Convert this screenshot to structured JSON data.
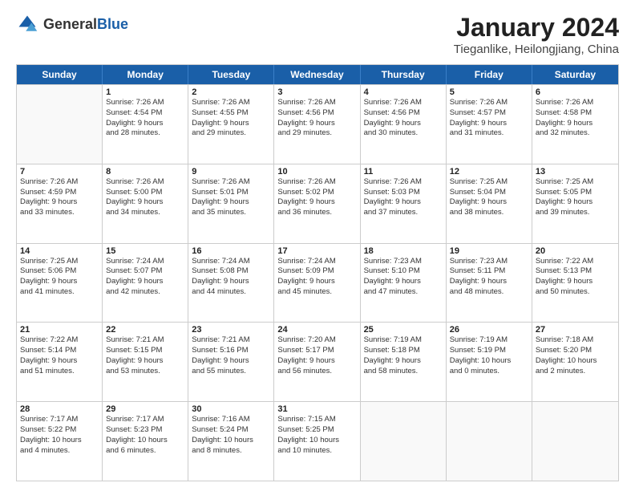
{
  "header": {
    "logo_general": "General",
    "logo_blue": "Blue",
    "title": "January 2024",
    "subtitle": "Tieganlike, Heilongjiang, China"
  },
  "days_of_week": [
    "Sunday",
    "Monday",
    "Tuesday",
    "Wednesday",
    "Thursday",
    "Friday",
    "Saturday"
  ],
  "rows": [
    [
      {
        "day": "",
        "lines": []
      },
      {
        "day": "1",
        "lines": [
          "Sunrise: 7:26 AM",
          "Sunset: 4:54 PM",
          "Daylight: 9 hours",
          "and 28 minutes."
        ]
      },
      {
        "day": "2",
        "lines": [
          "Sunrise: 7:26 AM",
          "Sunset: 4:55 PM",
          "Daylight: 9 hours",
          "and 29 minutes."
        ]
      },
      {
        "day": "3",
        "lines": [
          "Sunrise: 7:26 AM",
          "Sunset: 4:56 PM",
          "Daylight: 9 hours",
          "and 29 minutes."
        ]
      },
      {
        "day": "4",
        "lines": [
          "Sunrise: 7:26 AM",
          "Sunset: 4:56 PM",
          "Daylight: 9 hours",
          "and 30 minutes."
        ]
      },
      {
        "day": "5",
        "lines": [
          "Sunrise: 7:26 AM",
          "Sunset: 4:57 PM",
          "Daylight: 9 hours",
          "and 31 minutes."
        ]
      },
      {
        "day": "6",
        "lines": [
          "Sunrise: 7:26 AM",
          "Sunset: 4:58 PM",
          "Daylight: 9 hours",
          "and 32 minutes."
        ]
      }
    ],
    [
      {
        "day": "7",
        "lines": [
          "Sunrise: 7:26 AM",
          "Sunset: 4:59 PM",
          "Daylight: 9 hours",
          "and 33 minutes."
        ]
      },
      {
        "day": "8",
        "lines": [
          "Sunrise: 7:26 AM",
          "Sunset: 5:00 PM",
          "Daylight: 9 hours",
          "and 34 minutes."
        ]
      },
      {
        "day": "9",
        "lines": [
          "Sunrise: 7:26 AM",
          "Sunset: 5:01 PM",
          "Daylight: 9 hours",
          "and 35 minutes."
        ]
      },
      {
        "day": "10",
        "lines": [
          "Sunrise: 7:26 AM",
          "Sunset: 5:02 PM",
          "Daylight: 9 hours",
          "and 36 minutes."
        ]
      },
      {
        "day": "11",
        "lines": [
          "Sunrise: 7:26 AM",
          "Sunset: 5:03 PM",
          "Daylight: 9 hours",
          "and 37 minutes."
        ]
      },
      {
        "day": "12",
        "lines": [
          "Sunrise: 7:25 AM",
          "Sunset: 5:04 PM",
          "Daylight: 9 hours",
          "and 38 minutes."
        ]
      },
      {
        "day": "13",
        "lines": [
          "Sunrise: 7:25 AM",
          "Sunset: 5:05 PM",
          "Daylight: 9 hours",
          "and 39 minutes."
        ]
      }
    ],
    [
      {
        "day": "14",
        "lines": [
          "Sunrise: 7:25 AM",
          "Sunset: 5:06 PM",
          "Daylight: 9 hours",
          "and 41 minutes."
        ]
      },
      {
        "day": "15",
        "lines": [
          "Sunrise: 7:24 AM",
          "Sunset: 5:07 PM",
          "Daylight: 9 hours",
          "and 42 minutes."
        ]
      },
      {
        "day": "16",
        "lines": [
          "Sunrise: 7:24 AM",
          "Sunset: 5:08 PM",
          "Daylight: 9 hours",
          "and 44 minutes."
        ]
      },
      {
        "day": "17",
        "lines": [
          "Sunrise: 7:24 AM",
          "Sunset: 5:09 PM",
          "Daylight: 9 hours",
          "and 45 minutes."
        ]
      },
      {
        "day": "18",
        "lines": [
          "Sunrise: 7:23 AM",
          "Sunset: 5:10 PM",
          "Daylight: 9 hours",
          "and 47 minutes."
        ]
      },
      {
        "day": "19",
        "lines": [
          "Sunrise: 7:23 AM",
          "Sunset: 5:11 PM",
          "Daylight: 9 hours",
          "and 48 minutes."
        ]
      },
      {
        "day": "20",
        "lines": [
          "Sunrise: 7:22 AM",
          "Sunset: 5:13 PM",
          "Daylight: 9 hours",
          "and 50 minutes."
        ]
      }
    ],
    [
      {
        "day": "21",
        "lines": [
          "Sunrise: 7:22 AM",
          "Sunset: 5:14 PM",
          "Daylight: 9 hours",
          "and 51 minutes."
        ]
      },
      {
        "day": "22",
        "lines": [
          "Sunrise: 7:21 AM",
          "Sunset: 5:15 PM",
          "Daylight: 9 hours",
          "and 53 minutes."
        ]
      },
      {
        "day": "23",
        "lines": [
          "Sunrise: 7:21 AM",
          "Sunset: 5:16 PM",
          "Daylight: 9 hours",
          "and 55 minutes."
        ]
      },
      {
        "day": "24",
        "lines": [
          "Sunrise: 7:20 AM",
          "Sunset: 5:17 PM",
          "Daylight: 9 hours",
          "and 56 minutes."
        ]
      },
      {
        "day": "25",
        "lines": [
          "Sunrise: 7:19 AM",
          "Sunset: 5:18 PM",
          "Daylight: 9 hours",
          "and 58 minutes."
        ]
      },
      {
        "day": "26",
        "lines": [
          "Sunrise: 7:19 AM",
          "Sunset: 5:19 PM",
          "Daylight: 10 hours",
          "and 0 minutes."
        ]
      },
      {
        "day": "27",
        "lines": [
          "Sunrise: 7:18 AM",
          "Sunset: 5:20 PM",
          "Daylight: 10 hours",
          "and 2 minutes."
        ]
      }
    ],
    [
      {
        "day": "28",
        "lines": [
          "Sunrise: 7:17 AM",
          "Sunset: 5:22 PM",
          "Daylight: 10 hours",
          "and 4 minutes."
        ]
      },
      {
        "day": "29",
        "lines": [
          "Sunrise: 7:17 AM",
          "Sunset: 5:23 PM",
          "Daylight: 10 hours",
          "and 6 minutes."
        ]
      },
      {
        "day": "30",
        "lines": [
          "Sunrise: 7:16 AM",
          "Sunset: 5:24 PM",
          "Daylight: 10 hours",
          "and 8 minutes."
        ]
      },
      {
        "day": "31",
        "lines": [
          "Sunrise: 7:15 AM",
          "Sunset: 5:25 PM",
          "Daylight: 10 hours",
          "and 10 minutes."
        ]
      },
      {
        "day": "",
        "lines": []
      },
      {
        "day": "",
        "lines": []
      },
      {
        "day": "",
        "lines": []
      }
    ]
  ]
}
